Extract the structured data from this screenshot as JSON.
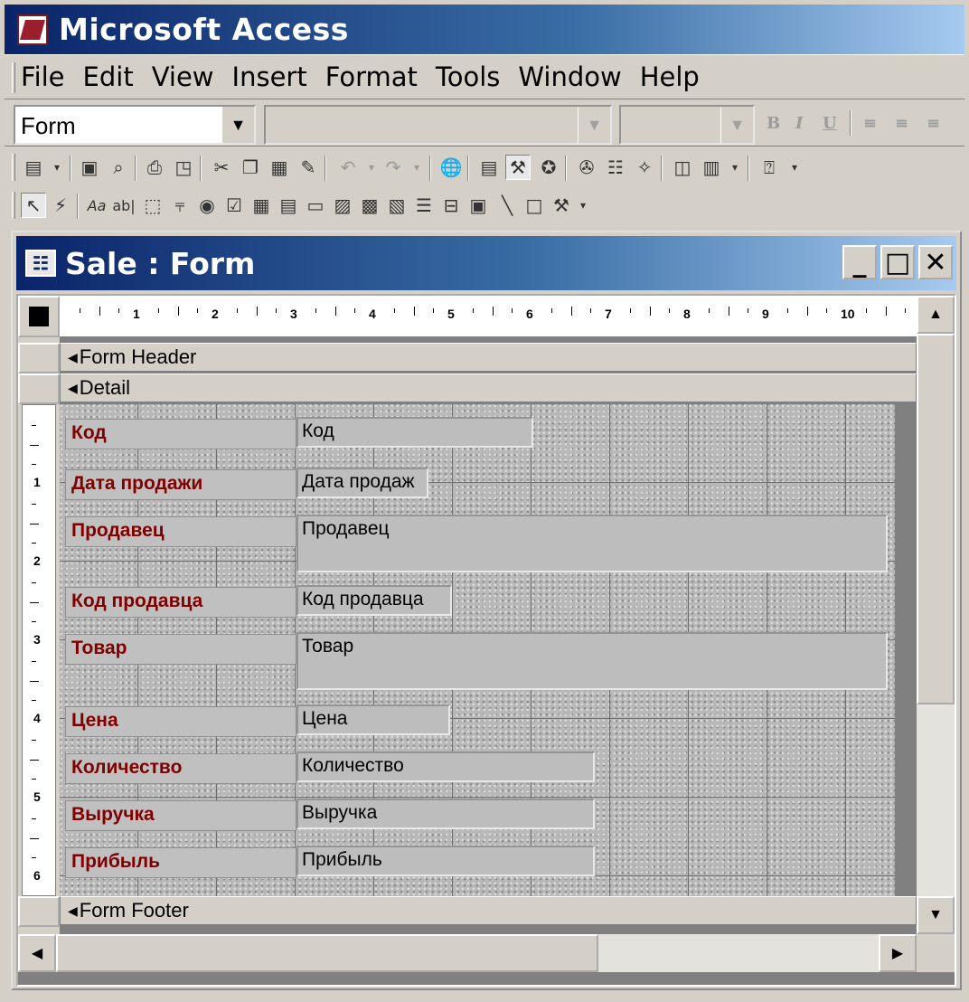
{
  "app": {
    "title": "Microsoft Access"
  },
  "menu": [
    {
      "label": "File"
    },
    {
      "label": "Edit"
    },
    {
      "label": "View"
    },
    {
      "label": "Insert"
    },
    {
      "label": "Format"
    },
    {
      "label": "Tools"
    },
    {
      "label": "Window"
    },
    {
      "label": "Help"
    }
  ],
  "format_toolbar": {
    "object_combo": "Form",
    "font_combo": "",
    "size_combo": "",
    "bold": "B",
    "italic": "I",
    "underline": "U"
  },
  "form_window": {
    "title": "Sale : Form",
    "minimize": "_",
    "maximize": "□",
    "close": "✕"
  },
  "ruler": {
    "horizontal": [
      "1",
      "2",
      "3",
      "4",
      "5",
      "6",
      "7",
      "8",
      "9",
      "10"
    ],
    "vertical": [
      "1",
      "2",
      "3",
      "4",
      "5",
      "6"
    ]
  },
  "sections": {
    "header": "Form Header",
    "detail": "Detail",
    "footer": "Form Footer"
  },
  "fields": [
    {
      "label": "Код",
      "control": "Код"
    },
    {
      "label": "Дата продажи",
      "control": "Дата продаж"
    },
    {
      "label": "Продавец",
      "control": "Продавец"
    },
    {
      "label": "Код продавца",
      "control": "Код продавца"
    },
    {
      "label": "Товар",
      "control": "Товар"
    },
    {
      "label": "Цена",
      "control": "Цена"
    },
    {
      "label": "Количество",
      "control": "Количество"
    },
    {
      "label": "Выручка",
      "control": "Выручка"
    },
    {
      "label": "Прибыль",
      "control": "Прибыль"
    }
  ],
  "colors": {
    "label_text": "#800000",
    "titlebar_start": "#0a246a",
    "titlebar_end": "#a6caf0"
  }
}
